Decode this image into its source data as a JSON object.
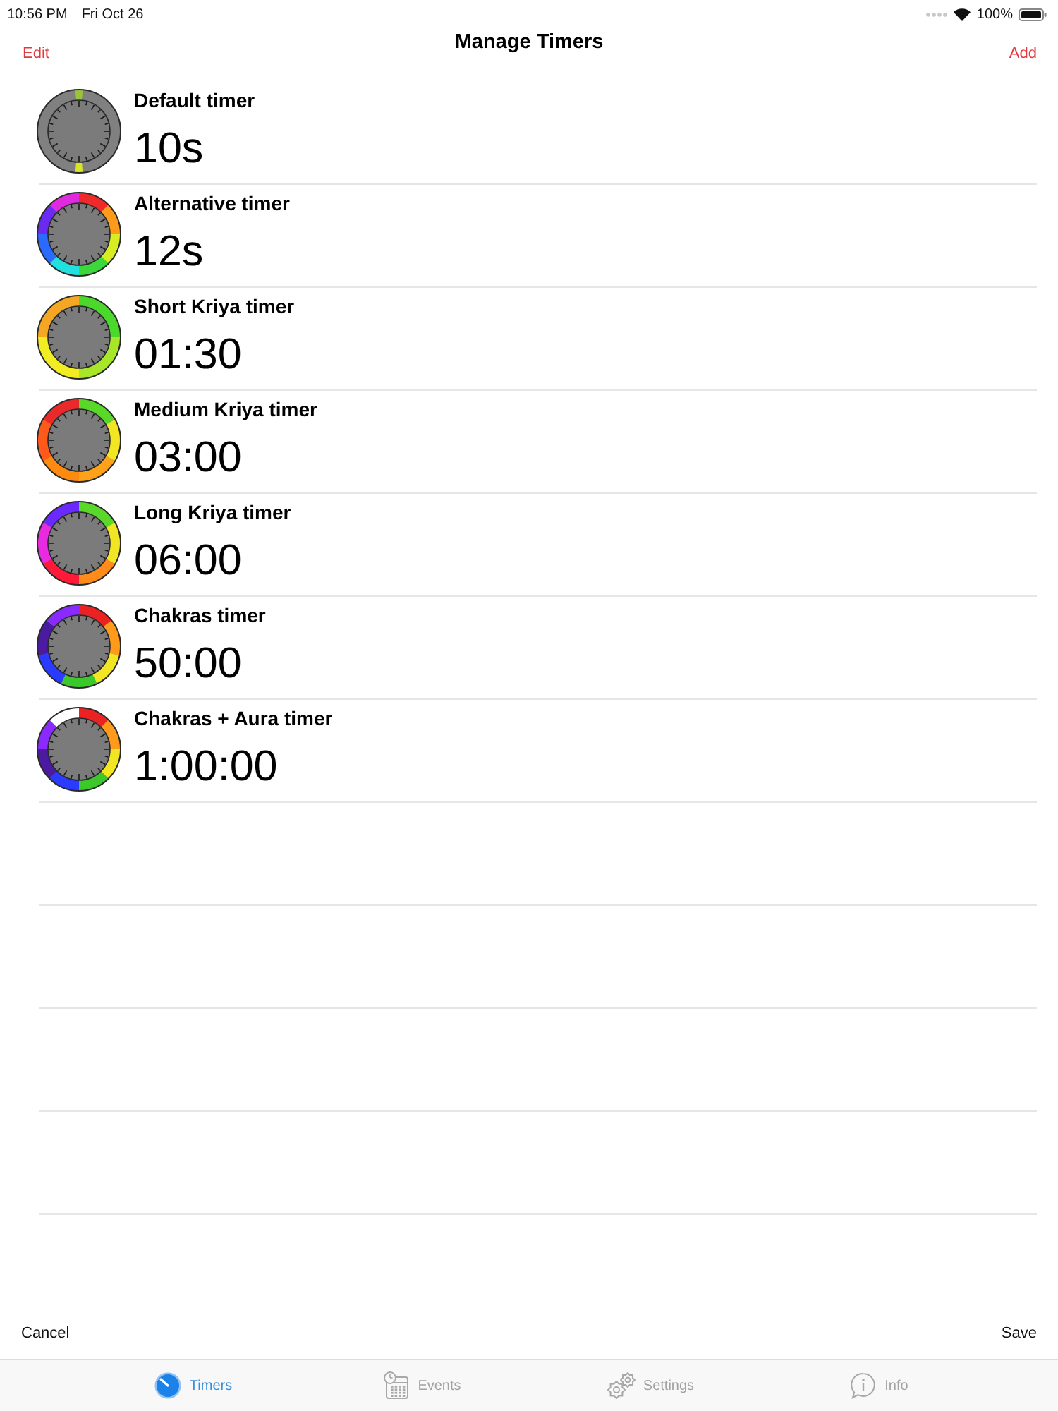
{
  "status_bar": {
    "time": "10:56 PM",
    "date": "Fri Oct 26",
    "battery": "100%"
  },
  "nav_bar": {
    "left_button": "Edit",
    "title": "Manage Timers",
    "right_button": "Add"
  },
  "timers": [
    {
      "name": "Default timer",
      "duration": "10s",
      "marks": [
        {
          "color": "#9ac43a"
        },
        {
          "color": "#d6e62a"
        }
      ]
    },
    {
      "name": "Alternative timer",
      "duration": "12s",
      "ring": [
        {
          "color": "#f02a2a"
        },
        {
          "color": "#ff9a1a"
        },
        {
          "color": "#d8ec22"
        },
        {
          "color": "#3ad83a"
        },
        {
          "color": "#22e0e0"
        },
        {
          "color": "#2a6aff"
        },
        {
          "color": "#6a2af0"
        },
        {
          "color": "#e02ae0"
        }
      ]
    },
    {
      "name": "Short Kriya timer",
      "duration": "01:30",
      "ring": [
        {
          "color": "#4ad82a"
        },
        {
          "color": "#a8e62a"
        },
        {
          "color": "#f2ec22"
        },
        {
          "color": "#f5a623"
        }
      ]
    },
    {
      "name": "Medium Kriya timer",
      "duration": "03:00",
      "ring": [
        {
          "color": "#5ad82a"
        },
        {
          "color": "#f2e622"
        },
        {
          "color": "#ffa21a"
        },
        {
          "color": "#ff8a10"
        },
        {
          "color": "#ff5a1a"
        },
        {
          "color": "#ea2a2a"
        }
      ]
    },
    {
      "name": "Long Kriya timer",
      "duration": "06:00",
      "ring": [
        {
          "color": "#5ad82a"
        },
        {
          "color": "#f2e622"
        },
        {
          "color": "#ff8c1a"
        },
        {
          "color": "#ff1a3a"
        },
        {
          "color": "#e82ae0"
        },
        {
          "color": "#6a2aff"
        }
      ]
    },
    {
      "name": "Chakras timer",
      "duration": "50:00",
      "ring": [
        {
          "color": "#ea2222"
        },
        {
          "color": "#ff9a1a"
        },
        {
          "color": "#f2e622"
        },
        {
          "color": "#3ac82a"
        },
        {
          "color": "#2a3aff"
        },
        {
          "color": "#4a1aa0"
        },
        {
          "color": "#8a2aff"
        }
      ]
    },
    {
      "name": "Chakras + Aura timer",
      "duration": "1:00:00",
      "ring": [
        {
          "color": "#ea2222"
        },
        {
          "color": "#ff9a1a"
        },
        {
          "color": "#f2e622"
        },
        {
          "color": "#3ac82a"
        },
        {
          "color": "#2a3aff"
        },
        {
          "color": "#4a1aa0"
        },
        {
          "color": "#8a2aff"
        },
        {
          "color": "#ffffff"
        }
      ]
    }
  ],
  "toolbar": {
    "left_button": "Cancel",
    "right_button": "Save"
  },
  "tabs": [
    {
      "label": "Timers",
      "selected": true
    },
    {
      "label": "Events",
      "selected": false
    },
    {
      "label": "Settings",
      "selected": false
    },
    {
      "label": "Info",
      "selected": false
    }
  ]
}
